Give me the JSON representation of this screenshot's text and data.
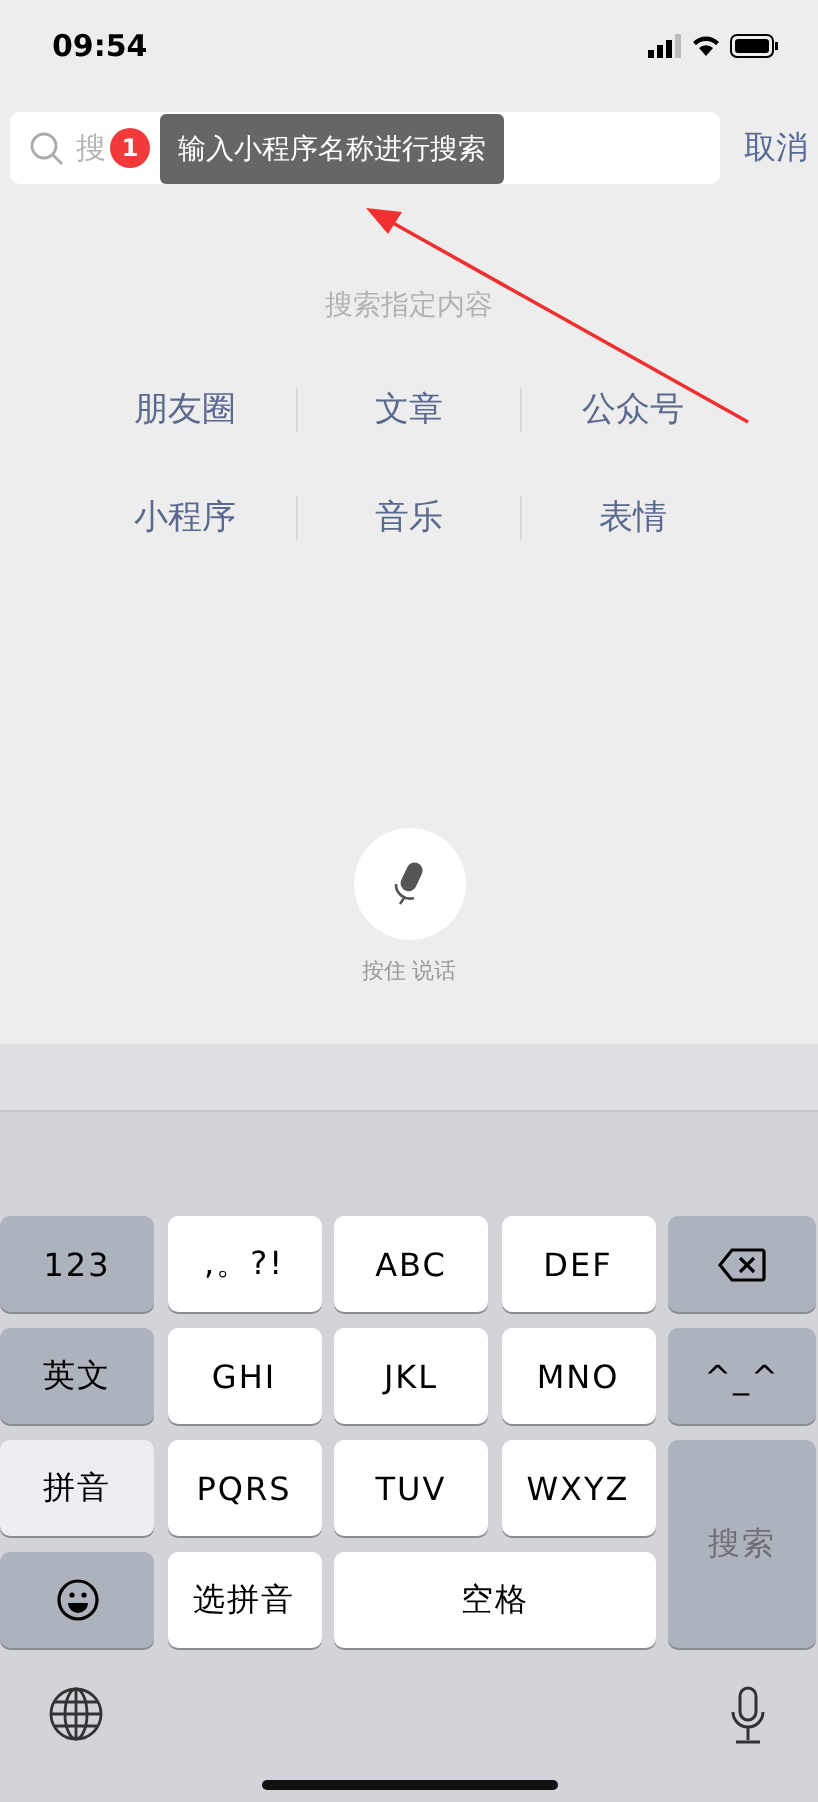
{
  "status_bar": {
    "time": "09:54"
  },
  "search": {
    "placeholder": "搜",
    "badge": "1",
    "tooltip": "输入小程序名称进行搜索",
    "cancel": "取消"
  },
  "section_title": "搜索指定内容",
  "categories": [
    [
      "朋友圈",
      "文章",
      "公众号"
    ],
    [
      "小程序",
      "音乐",
      "表情"
    ]
  ],
  "voice": {
    "label": "按住 说话"
  },
  "keys": [
    {
      "kind": "function",
      "label": "123"
    },
    {
      "kind": "char",
      "label": ",。?!"
    },
    {
      "kind": "char",
      "label": "ABC"
    },
    {
      "kind": "char",
      "label": "DEF"
    },
    {
      "kind": "delete"
    },
    {
      "kind": "mode",
      "label": "英文",
      "selected": false
    },
    {
      "kind": "char",
      "label": "GHI"
    },
    {
      "kind": "char",
      "label": "JKL"
    },
    {
      "kind": "char",
      "label": "MNO"
    },
    {
      "kind": "function",
      "label": "^_^"
    },
    {
      "kind": "mode",
      "label": "拼音",
      "selected": true
    },
    {
      "kind": "char",
      "label": "PQRS"
    },
    {
      "kind": "char",
      "label": "TUV"
    },
    {
      "kind": "char",
      "label": "WXYZ"
    },
    {
      "kind": "search",
      "label": "搜索"
    },
    {
      "kind": "emoji"
    },
    {
      "kind": "char",
      "label": "选拼音"
    },
    {
      "kind": "space",
      "label": "空格"
    }
  ]
}
